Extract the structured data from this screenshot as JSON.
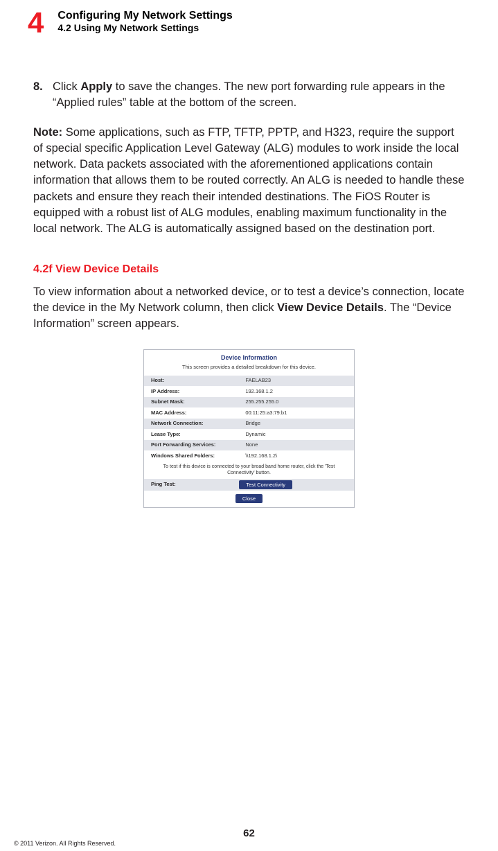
{
  "header": {
    "chapter_number": "4",
    "chapter_title": "Configuring My Network Settings",
    "chapter_subtitle": "4.2  Using My Network Settings"
  },
  "step": {
    "number": "8.",
    "prefix": "Click ",
    "bold": "Apply",
    "suffix": " to save the changes. The new port forwarding rule appears in the “Applied rules” table at the bottom of the screen."
  },
  "note": {
    "label": "Note:",
    "text": " Some applications, such as FTP, TFTP, PPTP, and H323, require the support of special specific Application Level Gateway (ALG) modules to work inside the local network. Data packets associated with the aforementioned applications contain information that allows them to be routed correctly. An ALG is needed to handle these packets and ensure they reach their intended destinations. The FiOS Router is equipped with a robust list of ALG modules, enabling maximum functionality in the local network. The ALG is automatically assigned based on the destination port."
  },
  "section": {
    "heading": "4.2f  View Device Details",
    "text_prefix": "To view information about a networked device, or to test a device’s connection, locate the device in the My Network column, then click ",
    "bold": "View Device Details",
    "text_suffix": ". The “Device Information” screen appears."
  },
  "device_info": {
    "title": "Device Information",
    "desc": "This screen provides a detailed breakdown for this device.",
    "rows": [
      {
        "label": "Host:",
        "value": "FAELAB23",
        "link": true
      },
      {
        "label": "IP Address:",
        "value": "192.168.1.2"
      },
      {
        "label": "Subnet Mask:",
        "value": "255.255.255.0"
      },
      {
        "label": "MAC Address:",
        "value": "00:11:25:a3:79:b1"
      },
      {
        "label": "Network Connection:",
        "value": "Bridge",
        "link": true
      },
      {
        "label": "Lease Type:",
        "value": "Dynamic"
      },
      {
        "label": "Port Forwarding Services:",
        "value": "None"
      },
      {
        "label": "Windows Shared Folders:",
        "value": "\\\\192.168.1.2\\",
        "link": true
      }
    ],
    "test_note": "To test if this device is connected to your broad band home router, click the 'Test Connectivity' button.",
    "ping_label": "Ping Test:",
    "test_btn": "Test Connectivity",
    "close_btn": "Close"
  },
  "footer": {
    "page": "62",
    "copyright": "© 2011 Verizon. All Rights Reserved."
  }
}
